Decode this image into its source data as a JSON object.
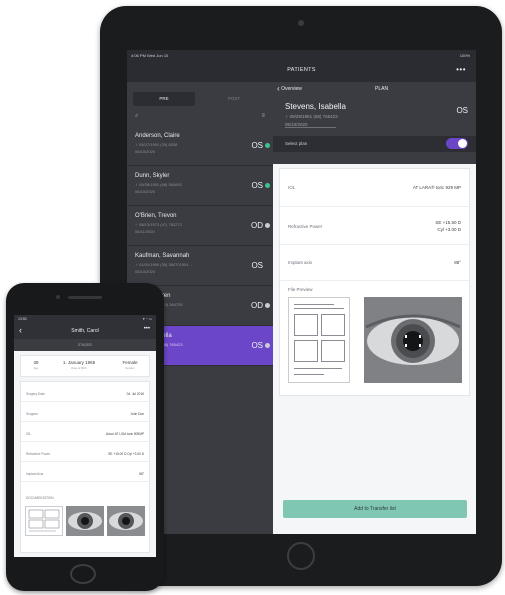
{
  "tablet": {
    "status": {
      "time": "4:06 PM  Wed Jun 10",
      "battery": "100%"
    },
    "header": {
      "title": "PATIENTS",
      "more": "•••"
    },
    "list": {
      "tabs": [
        "PRE",
        "POST"
      ],
      "patients": [
        {
          "name": "Anderson, Claire",
          "meta": "♀ 05/27/1991 (29) 8338",
          "date": "06/10/2020",
          "eye": "OS",
          "status_color": "#3ec58f"
        },
        {
          "name": "Dunn, Skyler",
          "meta": "♀ 09/28/1951 (68) 560692",
          "date": "06/10/2020",
          "eye": "OS",
          "status_color": "#3ec58f"
        },
        {
          "name": "O'Brien, Trevon",
          "meta": "♂ 08/13/1973 (47) 762272",
          "date": "06/11/2020",
          "eye": "OD",
          "status_color": "#c9ccd3"
        },
        {
          "name": "Kaufman, Savannah",
          "meta": "♀ 01/01/1990 (30) 364701904...",
          "date": "06/10/2020",
          "eye": "OS",
          "status_color": ""
        },
        {
          "name": "Warren",
          "meta": "1945 (74) 364705",
          "date": "",
          "eye": "OD",
          "status_color": "#c9ccd3"
        },
        {
          "name": "Isabella",
          "meta": "1951 (68) 765423",
          "date": "",
          "eye": "OS",
          "status_color": "#c9ccd3"
        }
      ]
    },
    "detail": {
      "nav_back": "Overview",
      "nav_plan": "PLAN",
      "patient_name": "Stevens, Isabella",
      "patient_meta": "♀ 09/28/1951 (68) 765423",
      "patient_date": "06/10/2020",
      "eye": "OS",
      "select_plan": "Select plan",
      "rows": [
        {
          "k": "IOL",
          "v": "AT LARA® toric 929 MP"
        },
        {
          "k": "Refractive Power",
          "v": "SE +15.50 D\nCyl +3.00 D"
        },
        {
          "k": "Implant axis",
          "v": "88°"
        }
      ],
      "file_preview": "File Preview",
      "add_button": "Add to Transfer list"
    }
  },
  "phone": {
    "status": {
      "time": "13:50",
      "right": "▾ ◔ ▭"
    },
    "title": "Smith, Carol",
    "more": "•••",
    "stage": "STAGED",
    "info": [
      {
        "v": "39",
        "s": "Age"
      },
      {
        "v": "1. January 1965",
        "s": "Date of Birth"
      },
      {
        "v": "Female",
        "s": "Gender"
      }
    ],
    "rows": [
      {
        "k": "Surgery Date",
        "v": "04. Jul 2016"
      },
      {
        "k": "Surgeon",
        "v": "John Doe"
      },
      {
        "k": "IOL",
        "v": "Alcon AT LISA toric 909MP"
      },
      {
        "k": "Refractive Power",
        "v": "SE +15.00 D Cyl +3.00 D"
      },
      {
        "k": "Implant Axis",
        "v": "88°"
      }
    ],
    "documents": "DOCUMENTATION"
  }
}
